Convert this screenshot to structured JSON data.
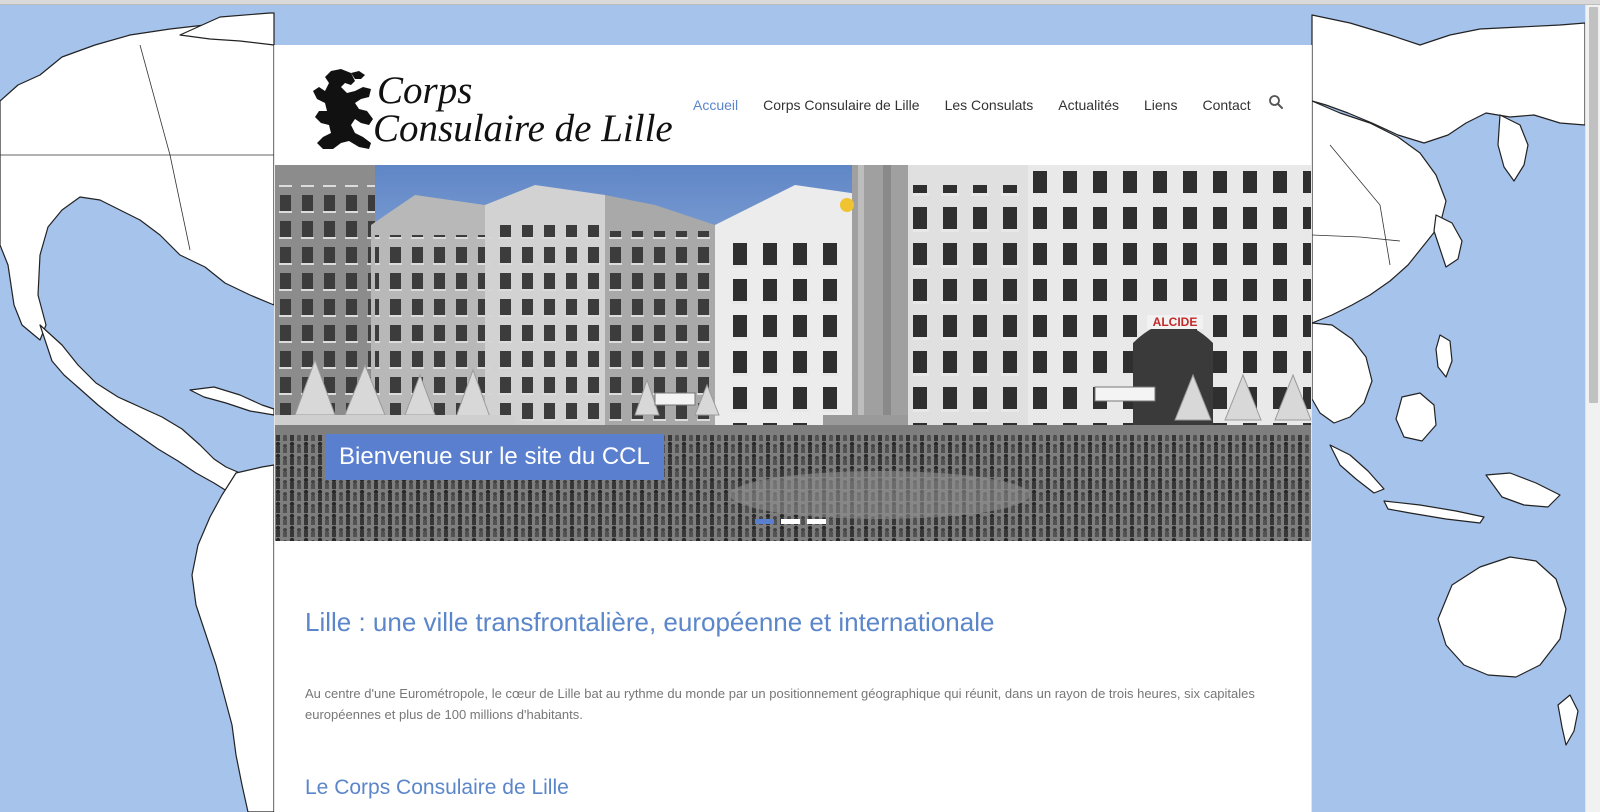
{
  "site": {
    "logo_line1": "Corps",
    "logo_line2": "Consulaire de Lille"
  },
  "nav": {
    "items": [
      {
        "label": "Accueil",
        "active": true
      },
      {
        "label": "Corps Consulaire de Lille",
        "active": false
      },
      {
        "label": "Les Consulats",
        "active": false
      },
      {
        "label": "Actualités",
        "active": false
      },
      {
        "label": "Liens",
        "active": false
      },
      {
        "label": "Contact",
        "active": false
      }
    ],
    "search_icon": "search-icon"
  },
  "slider": {
    "caption": "Bienvenue sur le site du CCL",
    "slide_count": 3,
    "active_slide": 1,
    "sign_text": "ALCIDE"
  },
  "content": {
    "heading": "Lille : une ville transfrontalière, européenne et internationale",
    "paragraph": "Au centre d'une Eurométropole, le cœur de Lille bat au rythme du monde par un positionnement géographique qui réunit, dans un rayon de trois heures, six capitales européennes et plus de 100 millions d'habitants.",
    "subheading": "Le Corps Consulaire de Lille"
  },
  "colors": {
    "accent": "#5b86c9",
    "caption_bg": "#5b7fcf",
    "map_ocean": "#a6c3ec",
    "map_land": "#ffffff"
  }
}
